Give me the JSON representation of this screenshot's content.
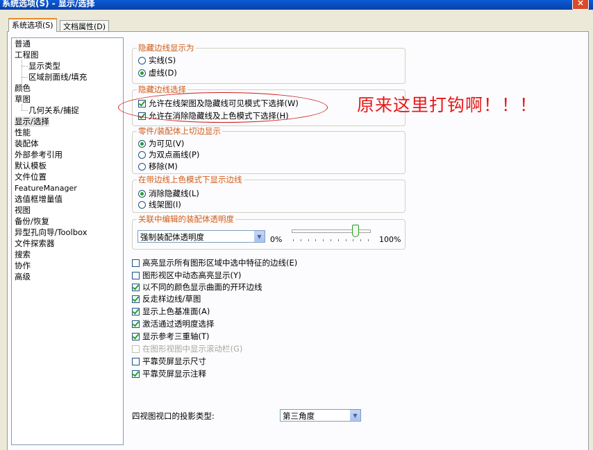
{
  "window": {
    "title": "系统选项(S) - 显示/选择",
    "close_label": "×"
  },
  "tabs": [
    {
      "label": "系统选项(S)"
    },
    {
      "label": "文档属性(D)"
    }
  ],
  "sidebar": {
    "items": [
      {
        "label": "普通"
      },
      {
        "label": "工程图"
      },
      {
        "label": "显示类型"
      },
      {
        "label": "区域剖面线/填充"
      },
      {
        "label": "颜色"
      },
      {
        "label": "草图"
      },
      {
        "label": "几何关系/捕捉"
      },
      {
        "label": "显示/选择"
      },
      {
        "label": "性能"
      },
      {
        "label": "装配体"
      },
      {
        "label": "外部参考引用"
      },
      {
        "label": "默认模板"
      },
      {
        "label": "文件位置"
      },
      {
        "label": "FeatureManager"
      },
      {
        "label": "选值框增量值"
      },
      {
        "label": "视图"
      },
      {
        "label": "备份/恢复"
      },
      {
        "label": "异型孔向导/Toolbox"
      },
      {
        "label": "文件探索器"
      },
      {
        "label": "搜索"
      },
      {
        "label": "协作"
      },
      {
        "label": "高级"
      }
    ],
    "selected": "显示/选择"
  },
  "hidden_edges_display": {
    "title": "隐藏边线显示为",
    "options": [
      {
        "label": "实线(S)",
        "selected": false
      },
      {
        "label": "虚线(D)",
        "selected": true
      }
    ]
  },
  "hidden_edges_select": {
    "title": "隐藏边线选择",
    "options": [
      {
        "label": "允许在线架图及隐藏线可见模式下选择(W)",
        "checked": true
      },
      {
        "label": "允许在消除隐藏线及上色模式下选择(H)",
        "checked": true
      }
    ]
  },
  "part_assembly_tangent": {
    "title": "零件/装配体上切边显示",
    "options": [
      {
        "label": "为可见(V)",
        "selected": true
      },
      {
        "label": "为双点画线(P)",
        "selected": false
      },
      {
        "label": "移除(M)",
        "selected": false
      }
    ]
  },
  "shaded_edges_mode": {
    "title": "在带边线上色模式下显示边线",
    "options": [
      {
        "label": "消除隐藏线(L)",
        "selected": true
      },
      {
        "label": "线架图(I)",
        "selected": false
      }
    ]
  },
  "transparency": {
    "title": "关联中编辑的装配体透明度",
    "dropdown_value": "强制装配体透明度",
    "min_label": "0%",
    "max_label": "100%",
    "slider_fraction": 0.82
  },
  "checkboxes": [
    {
      "label": "高亮显示所有图形区域中选中特征的边线(E)",
      "checked": false,
      "disabled": false
    },
    {
      "label": "图形视区中动态高亮显示(Y)",
      "checked": false,
      "disabled": false
    },
    {
      "label": "以不同的颜色显示曲面的开环边线",
      "checked": true,
      "disabled": false
    },
    {
      "label": "反走样边线/草图",
      "checked": true,
      "disabled": false
    },
    {
      "label": "显示上色基准面(A)",
      "checked": true,
      "disabled": false
    },
    {
      "label": "激活通过透明度选择",
      "checked": true,
      "disabled": false
    },
    {
      "label": "显示参考三重轴(T)",
      "checked": true,
      "disabled": false
    },
    {
      "label": "在图形视图中显示滚动栏(G)",
      "checked": false,
      "disabled": true
    },
    {
      "label": "平靠荧屏显示尺寸",
      "checked": false,
      "disabled": false
    },
    {
      "label": "平靠荧屏显示注释",
      "checked": true,
      "disabled": false
    }
  ],
  "projection": {
    "label": "四视图视口的投影类型:",
    "value": "第三角度"
  },
  "annotation": {
    "text": "原来这里打钩啊！！！",
    "color": "#e81818"
  },
  "colors": {
    "title_bar": "#0a5bd8",
    "group_title": "#d05a17",
    "check_mark": "#21a121"
  }
}
